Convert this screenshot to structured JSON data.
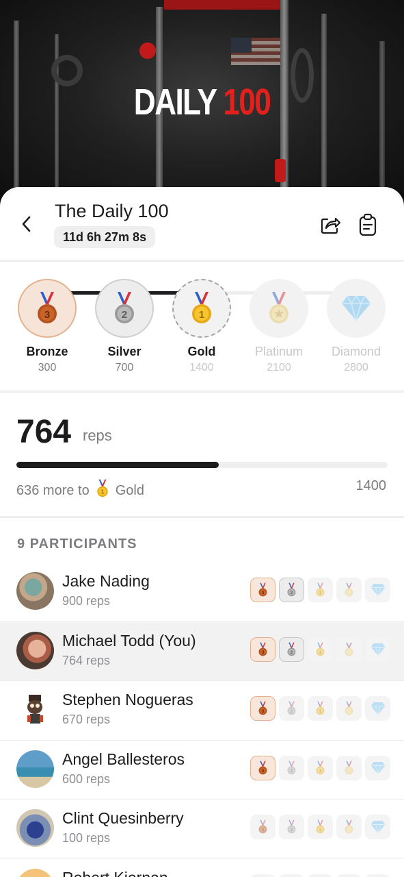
{
  "hero": {
    "title_white": "DAILY",
    "title_red": "100"
  },
  "challenge": {
    "title": "The Daily 100",
    "timer": "11d 6h 27m 8s"
  },
  "icons": {
    "back": "chevron-left-icon",
    "share": "share-icon",
    "clipboard": "clipboard-icon"
  },
  "tiers": [
    {
      "name": "Bronze",
      "value": "300",
      "medal_text": "3",
      "reached": true
    },
    {
      "name": "Silver",
      "value": "700",
      "medal_text": "2",
      "reached": true
    },
    {
      "name": "Gold",
      "value": "1400",
      "medal_text": "1",
      "reached": false,
      "current_goal": true
    },
    {
      "name": "Platinum",
      "value": "2100",
      "reached": false
    },
    {
      "name": "Diamond",
      "value": "2800",
      "reached": false
    }
  ],
  "progress": {
    "reps": "764",
    "unit": "reps",
    "fraction": 0.5457,
    "more_prefix": "636 more to",
    "next_tier": "Gold",
    "next_tier_medal_text": "1",
    "goal": "1400"
  },
  "participants_header": "9 PARTICIPANTS",
  "participants": [
    {
      "name": "Jake Nading",
      "reps": "900 reps",
      "earned": [
        true,
        true,
        false,
        false,
        false
      ],
      "me": false
    },
    {
      "name": "Michael Todd (You)",
      "reps": "764 reps",
      "earned": [
        true,
        true,
        false,
        false,
        false
      ],
      "me": true
    },
    {
      "name": "Stephen Nogueras",
      "reps": "670 reps",
      "earned": [
        true,
        false,
        false,
        false,
        false
      ],
      "me": false
    },
    {
      "name": "Angel Ballesteros",
      "reps": "600 reps",
      "earned": [
        true,
        false,
        false,
        false,
        false
      ],
      "me": false
    },
    {
      "name": "Clint Quesinberry",
      "reps": "100 reps",
      "earned": [
        false,
        false,
        false,
        false,
        false
      ],
      "me": false
    },
    {
      "name": "Robert Kiernan",
      "reps": "",
      "earned": [
        false,
        false,
        false,
        false,
        false
      ],
      "me": false
    }
  ],
  "colors": {
    "bronze": "#b4511f",
    "silver": "#9a9a9a",
    "gold": "#e8a813",
    "platinum": "#e6c86a",
    "diamond": "#7cc7f2",
    "accent_red": "#e3201b"
  }
}
